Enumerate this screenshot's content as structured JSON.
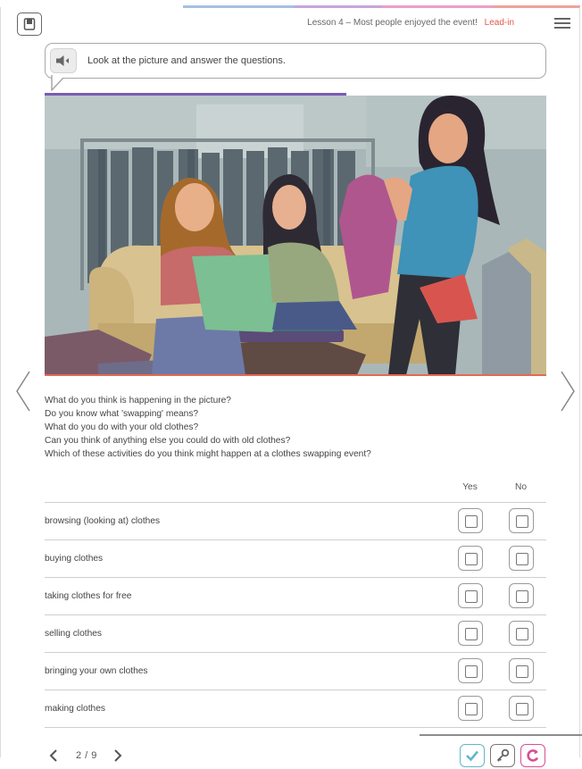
{
  "header": {
    "lesson_title": "Lesson 4 – Most people enjoyed the event!",
    "section_label": "Lead-in"
  },
  "instruction": {
    "text": "Look at the picture and answer the questions."
  },
  "illustration": {
    "description_icon": "clothes-swapping-illustration"
  },
  "questions": [
    "What do you think is happening in the picture?",
    "Do you know what 'swapping' means?",
    "What do you do with your old clothes?",
    "Can you think of anything else you could do with old clothes?",
    "Which of these activities do you think might happen at a clothes swapping event?"
  ],
  "table": {
    "col_yes": "Yes",
    "col_no": "No",
    "rows": [
      "browsing (looking at) clothes",
      "buying clothes",
      "taking clothes for free",
      "selling clothes",
      "bringing your own clothes",
      "making clothes"
    ]
  },
  "pager": {
    "current_of_total": "2 / 9"
  },
  "colors": {
    "accent_red": "#e2574c",
    "accent_purple": "#7a5bb5",
    "check_teal": "#5fb7c9",
    "reset_pink": "#d94f98"
  },
  "icons": {
    "book": "book-icon",
    "menu": "hamburger-menu-icon",
    "speaker": "speaker-icon",
    "prev": "chevron-left-icon",
    "next": "chevron-right-icon",
    "check": "checkmark-icon",
    "key": "key-icon",
    "reset": "reset-icon"
  }
}
